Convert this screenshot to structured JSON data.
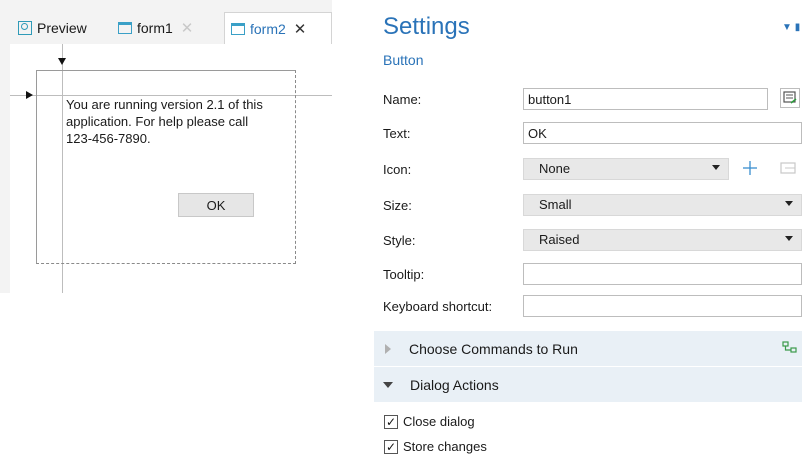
{
  "tabs": [
    {
      "label": "Preview",
      "icon": "preview-icon"
    },
    {
      "label": "form1",
      "icon": "form-icon",
      "close": "✕"
    },
    {
      "label": "form2",
      "icon": "form-icon",
      "close": "✕"
    }
  ],
  "form_preview": {
    "message": "You are running version 2.1 of this application. For help please call 123-456-7890.",
    "ok_label": "OK"
  },
  "settings": {
    "title": "Settings",
    "subtitle": "Button",
    "fields": {
      "name": {
        "label": "Name:",
        "value": "button1"
      },
      "text": {
        "label": "Text:",
        "value": "OK"
      },
      "icon": {
        "label": "Icon:",
        "value": "None"
      },
      "size": {
        "label": "Size:",
        "value": "Small"
      },
      "style": {
        "label": "Style:",
        "value": "Raised"
      },
      "tooltip": {
        "label": "Tooltip:",
        "value": ""
      },
      "shortcut": {
        "label": "Keyboard shortcut:",
        "value": ""
      }
    },
    "sections": {
      "commands": "Choose Commands to Run",
      "dialog": "Dialog Actions"
    },
    "checkboxes": {
      "close_dialog": {
        "label": "Close dialog",
        "checked": true
      },
      "store_changes": {
        "label": "Store changes",
        "checked": true
      }
    }
  },
  "colors": {
    "accent": "#2a73b8",
    "section_bg": "#e9f0f6",
    "editor_bg": "#f3f3f3"
  }
}
